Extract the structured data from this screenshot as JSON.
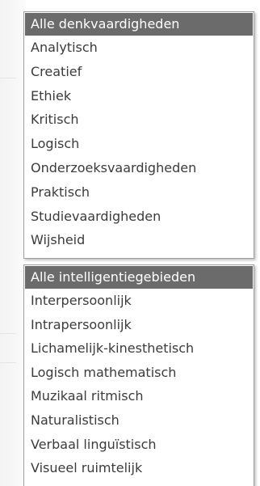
{
  "dropdowns": [
    {
      "selected": "Alle denkvaardigheden",
      "options": [
        "Alle denkvaardigheden",
        "Analytisch",
        "Creatief",
        "Ethiek",
        "Kritisch",
        "Logisch",
        "Onderzoeksvaardigheden",
        "Praktisch",
        "Studievaardigheden",
        "Wijsheid"
      ]
    },
    {
      "selected": "Alle intelligentiegebieden",
      "options": [
        "Alle intelligentiegebieden",
        "Interpersoonlijk",
        "Intrapersoonlijk",
        "Lichamelijk-kinesthetisch",
        "Logisch mathematisch",
        "Muzikaal ritmisch",
        "Naturalistisch",
        "Verbaal linguïstisch",
        "Visueel ruimtelijk"
      ]
    }
  ],
  "colors": {
    "selected_bg": "#6b6b6b",
    "selected_text": "#ffffff",
    "option_text": "#3b3b3b",
    "border": "#9f9f9f"
  }
}
